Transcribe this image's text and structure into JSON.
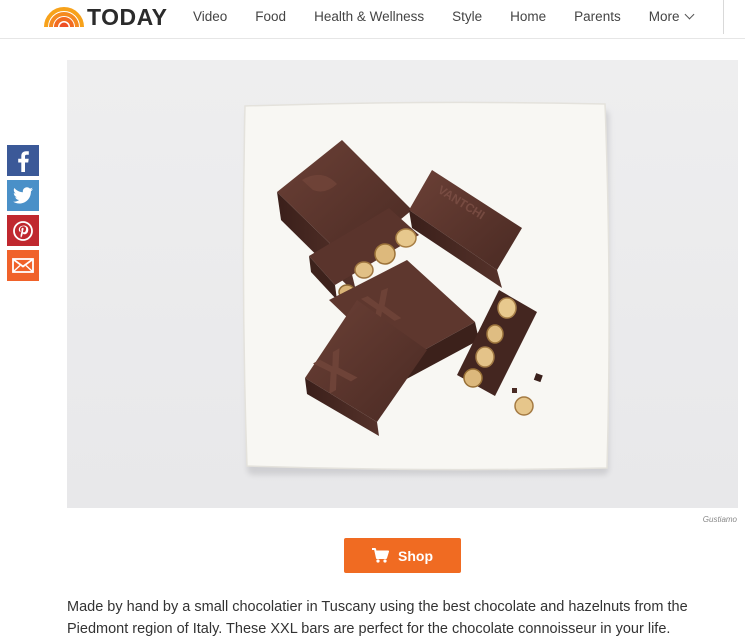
{
  "header": {
    "logo_text": "TODAY",
    "nav": [
      "Video",
      "Food",
      "Health & Wellness",
      "Style",
      "Home",
      "Parents"
    ],
    "more_label": "More"
  },
  "share": {
    "items": [
      "facebook-icon",
      "twitter-icon",
      "pinterest-icon",
      "email-icon"
    ],
    "colors": {
      "facebook": "#3b5998",
      "twitter": "#4a90c8",
      "pinterest": "#c0282f",
      "email": "#f0622a"
    }
  },
  "image": {
    "credit": "Gustiamo"
  },
  "shop": {
    "label": "Shop",
    "color": "#f06b22"
  },
  "article": {
    "paragraph": "Made by hand by a small chocolatier in Tuscany using the best chocolate and hazelnuts from the Piedmont region of Italy. These XXL bars are perfect for the chocolate connoisseur in your life."
  }
}
